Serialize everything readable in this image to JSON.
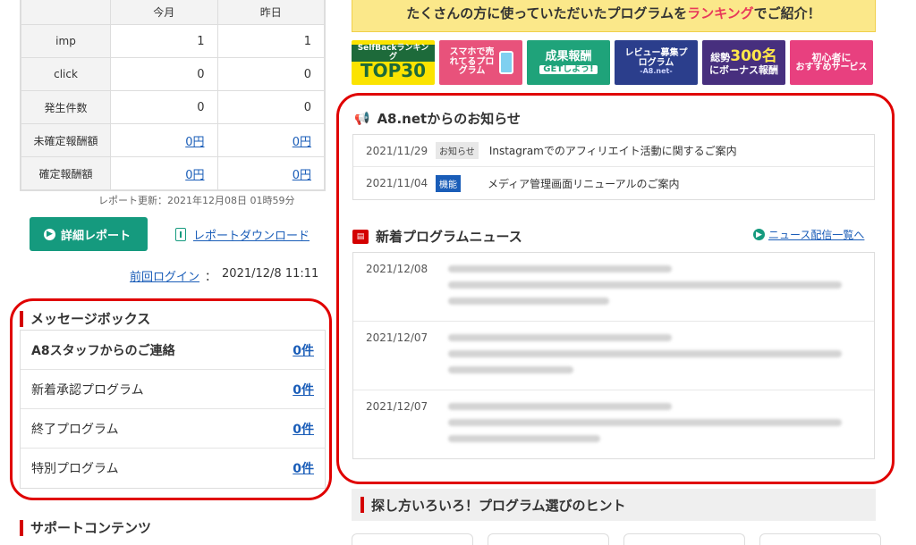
{
  "stats": {
    "col_headers": [
      "今月",
      "昨日"
    ],
    "rows": [
      {
        "label": "imp",
        "month": "1",
        "yesterday": "1",
        "link": false
      },
      {
        "label": "click",
        "month": "0",
        "yesterday": "0",
        "link": false
      },
      {
        "label": "発生件数",
        "month": "0",
        "yesterday": "0",
        "link": false
      },
      {
        "label": "未確定報酬額",
        "month": "0円",
        "yesterday": "0円",
        "link": true
      },
      {
        "label": "確定報酬額",
        "month": "0円",
        "yesterday": "0円",
        "link": true
      }
    ],
    "updated": "レポート更新：2021年12月08日 01時59分"
  },
  "actions": {
    "detail_report": "詳細レポート",
    "report_download": "レポートダウンロード"
  },
  "last_login": {
    "label": "前回ログイン",
    "value": "2021/12/8 11:11"
  },
  "message_box": {
    "title": "メッセージボックス",
    "items": [
      {
        "label": "A8スタッフからのご連絡",
        "count": "0件"
      },
      {
        "label": "新着承認プログラム",
        "count": "0件"
      },
      {
        "label": "終了プログラム",
        "count": "0件"
      },
      {
        "label": "特別プログラム",
        "count": "0件"
      }
    ]
  },
  "support_title": "サポートコンテンツ",
  "banner": {
    "pre": "たくさんの方に使っていただいたプログラムを",
    "highlight": "ランキング",
    "post": "でご紹介！"
  },
  "banners": [
    {
      "small": "SelfBackランキング",
      "big": "TOP30"
    },
    {
      "text": "スマホで売れてるプログラム"
    },
    {
      "big": "成果報酬",
      "small": "GETしよう!"
    },
    {
      "big": "レビュー募集プログラム",
      "small": "-A8.net-"
    },
    {
      "pre": "総勢",
      "big": "300名",
      "post": "にボーナス報酬"
    },
    {
      "big": "初心者に",
      "small": "おすすめサービス"
    }
  ],
  "notices": {
    "title": "A8.netからのお知らせ",
    "items": [
      {
        "date": "2021/11/29",
        "tag": "お知らせ",
        "text": "Instagramでのアフィリエイト活動に関するご案内"
      },
      {
        "date": "2021/11/04",
        "tag": "機能",
        "text": "メディア管理画面リニューアルのご案内"
      }
    ]
  },
  "news": {
    "title": "新着プログラムニュース",
    "link": "ニュース配信一覧へ",
    "dates": [
      "2021/12/08",
      "2021/12/07",
      "2021/12/07"
    ]
  },
  "hint_title": "探し方いろいろ！プログラム選びのヒント",
  "colors": {
    "accent_red": "#d40000",
    "green": "#159a7e",
    "link_blue": "#1a5db8",
    "callout": "#e00000"
  }
}
